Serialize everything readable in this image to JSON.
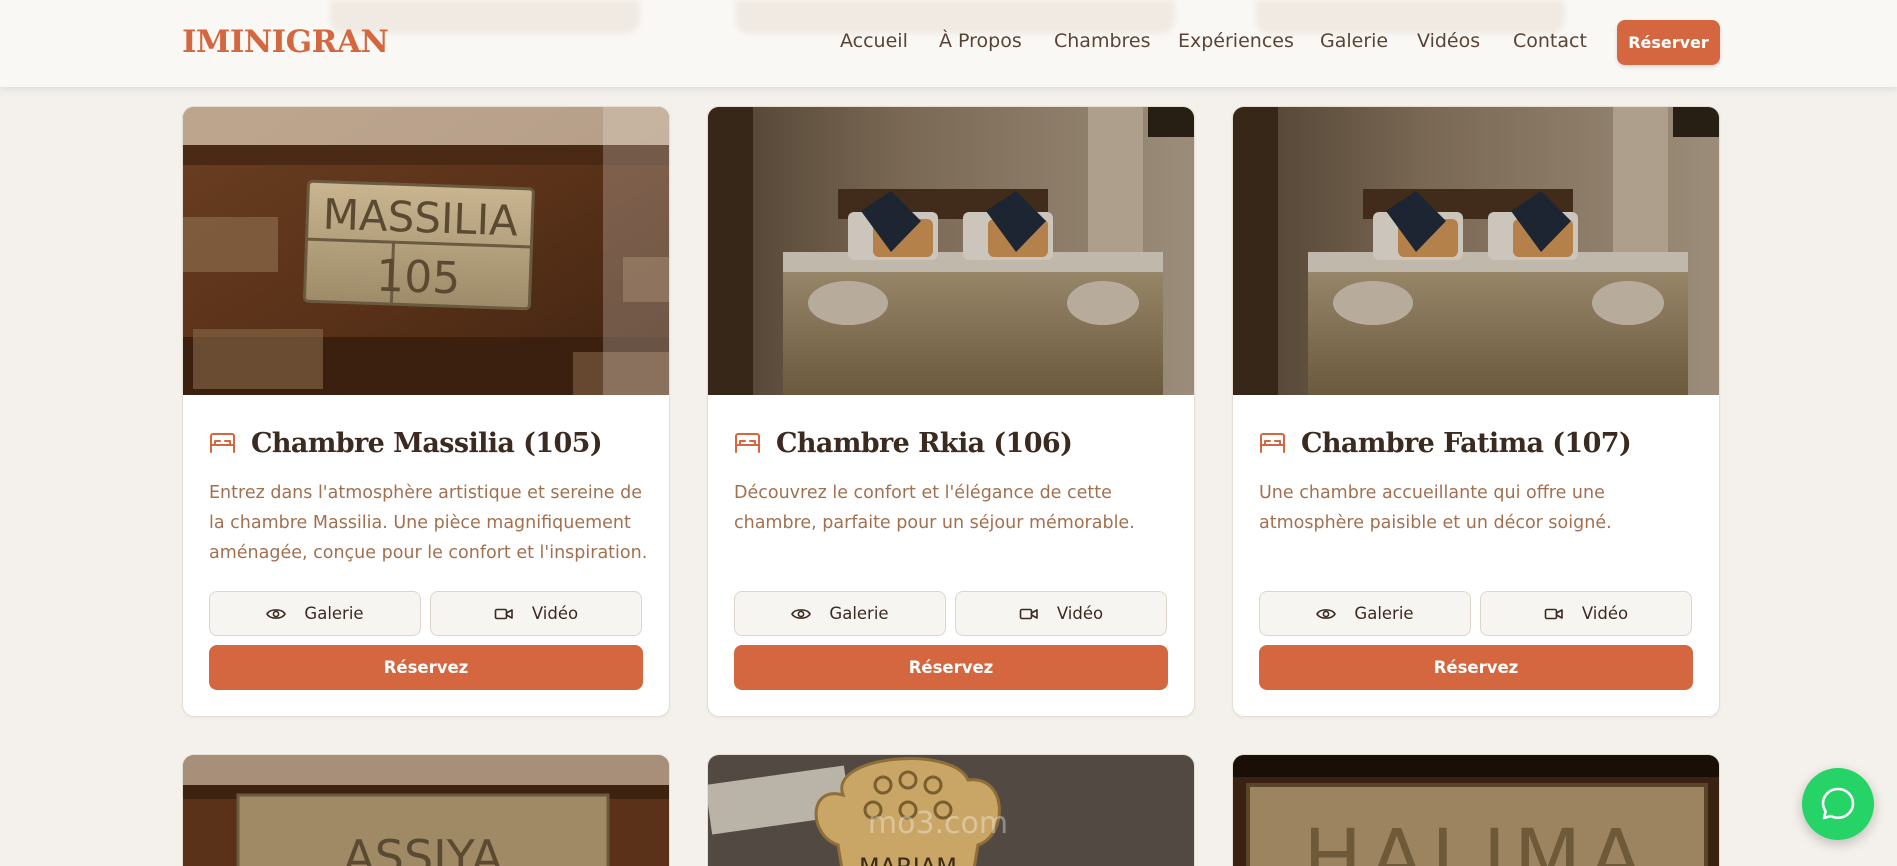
{
  "site": {
    "logo": "IMINIGRAN"
  },
  "nav": {
    "items": [
      "Accueil",
      "À Propos",
      "Chambres",
      "Expériences",
      "Galerie",
      "Vidéos",
      "Contact"
    ],
    "cta_label": "Réserver"
  },
  "rooms": [
    {
      "title": "Chambre Massilia (105)",
      "description": "Entrez dans l'atmosphère artistique et sereine de la chambre Massilia. Une pièce magnifiquement aménagée, conçue pour le confort et l'inspiration.",
      "gallery_label": "Galerie",
      "video_label": "Vidéo",
      "reserve_label": "Réservez",
      "image_text_line1": "MASSILIA",
      "image_text_line2": "105"
    },
    {
      "title": "Chambre Rkia (106)",
      "description": "Découvrez le confort et l'élégance de cette chambre, parfaite pour un séjour mémorable.",
      "gallery_label": "Galerie",
      "video_label": "Vidéo",
      "reserve_label": "Réservez"
    },
    {
      "title": "Chambre Fatima (107)",
      "description": "Une chambre accueillante qui offre une atmosphère paisible et un décor soigné.",
      "gallery_label": "Galerie",
      "video_label": "Vidéo",
      "reserve_label": "Réservez"
    }
  ],
  "next_rooms_image_text": [
    "ASSIYA",
    "MARIAM",
    "HALIMA"
  ],
  "watermark": "mo3.com",
  "icons": {
    "room": "bed-icon",
    "gallery": "eye-icon",
    "video": "video-camera-icon",
    "chat": "whatsapp-icon"
  },
  "colors": {
    "accent": "#d4673f",
    "background": "#f4f1ec",
    "text": "#3b2a1f",
    "muted_text": "#a3704f",
    "whatsapp": "#25d366"
  }
}
